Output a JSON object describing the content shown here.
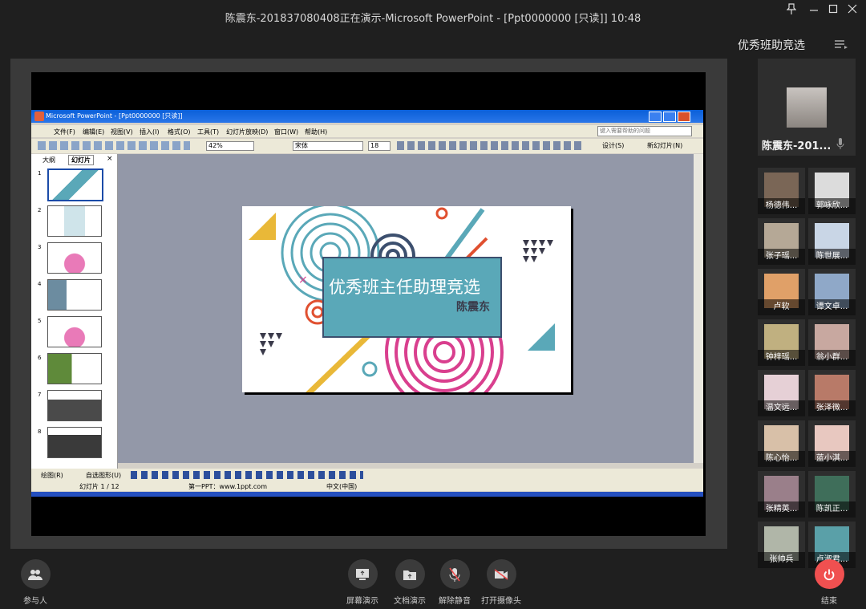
{
  "window": {
    "title": "陈震东-201837080408正在演示-Microsoft PowerPoint - [Ppt0000000 [只读]] 10:48"
  },
  "ppt": {
    "title_bar": "Microsoft PowerPoint - [Ppt0000000 [只读]]",
    "menu": [
      "文件(F)",
      "编辑(E)",
      "视图(V)",
      "插入(I)",
      "格式(O)",
      "工具(T)",
      "幻灯片放映(D)",
      "窗口(W)",
      "帮助(H)"
    ],
    "help_placeholder": "键入需要帮助的问题",
    "zoom": "42%",
    "font_name": "宋体",
    "font_size": "18",
    "design_label": "设计(S)",
    "new_slide_label": "新幻灯片(N)",
    "tabs": [
      "大纲",
      "幻灯片"
    ],
    "slide_numbers": [
      "1",
      "2",
      "3",
      "4",
      "5",
      "6",
      "7",
      "8"
    ],
    "draw_label": "绘图(R)",
    "autoshape_label": "自选图形(U)",
    "status": {
      "slide": "幻灯片 1 / 12",
      "template": "第一PPT：www.1ppt.com",
      "language": "中文(中国)"
    },
    "slide": {
      "title": "优秀班主任助理竞选",
      "subtitle": "陈震东"
    }
  },
  "right_panel": {
    "title": "优秀班助竞选",
    "presenter_name": "陈震东-201...",
    "participants": [
      "杨德伟...",
      "郭咏欣...",
      "张子瑶...",
      "陈世展...",
      "卢软",
      "谭文卓...",
      "钟梓瑶...",
      "翁小群...",
      "温文远...",
      "张泽微...",
      "陈心怡...",
      "蓝小淇...",
      "张精英...",
      "陈凯正...",
      "张帅兵",
      "卢淑君..."
    ]
  },
  "bottom_bar": {
    "participants_label": "参与人",
    "screen_share_label": "屏幕演示",
    "doc_share_label": "文档演示",
    "unmute_label": "解除静音",
    "camera_label": "打开摄像头",
    "end_label": "结束"
  },
  "colors": {
    "end_button": "#f05050",
    "slide_accent_teal": "#5aa8b8",
    "slide_accent_pink": "#d93f8e",
    "slide_accent_yellow": "#e9b838"
  }
}
